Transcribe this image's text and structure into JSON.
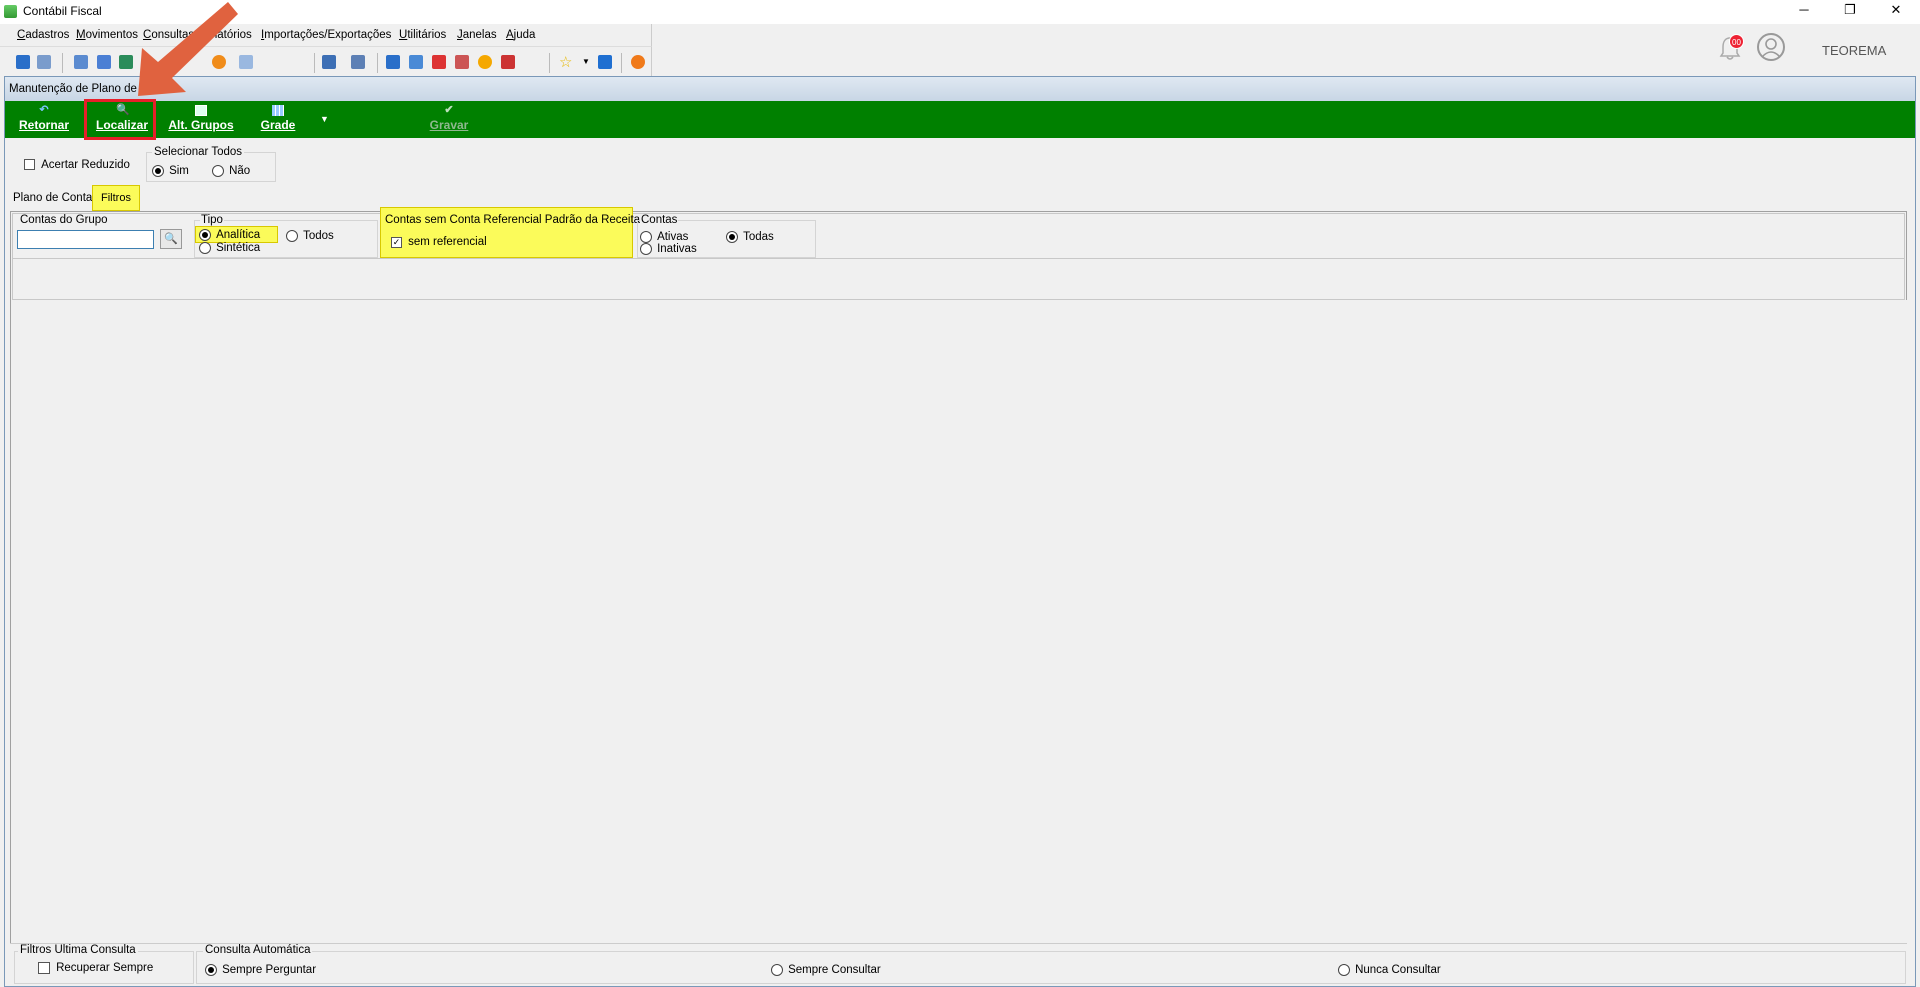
{
  "window": {
    "title": "Contábil Fiscal",
    "minimize": "─",
    "maximize": "❐",
    "close": "✕"
  },
  "menu": [
    {
      "u": "C",
      "rest": "adastros"
    },
    {
      "u": "M",
      "rest": "ovimentos"
    },
    {
      "u": "C",
      "rest": "onsultas"
    },
    {
      "u": "R",
      "rest": "elatórios"
    },
    {
      "u": "I",
      "rest": "mportações/Exportações"
    },
    {
      "u": "U",
      "rest": "tilitários"
    },
    {
      "u": "J",
      "rest": "anelas"
    },
    {
      "u": "A",
      "rest": "juda"
    }
  ],
  "user": {
    "notifications": "00",
    "name": "TEOREMA"
  },
  "form": {
    "title": "Manutenção de Plano de",
    "buttons": {
      "retornar": "Retornar",
      "localizar": "Localizar",
      "alt_grupos": "Alt. Grupos",
      "grade": "Grade",
      "gravar": "Gravar"
    },
    "acertar_reduzido": "Acertar Reduzido",
    "selecionar_todos": {
      "label": "Selecionar Todos",
      "sim": "Sim",
      "nao": "Não",
      "selected": "Sim"
    },
    "tabs": {
      "plano": "Plano de Contas",
      "filtros": "Filtros"
    },
    "filters": {
      "contas_grupo": {
        "label": "Contas do Grupo",
        "value": ""
      },
      "tipo": {
        "label": "Tipo",
        "analitica": "Analítica",
        "sintetica": "Sintética",
        "todos": "Todos",
        "selected": "Analítica"
      },
      "referencial": {
        "label": "Contas sem Conta Referencial Padrão da Receita",
        "check": "sem referencial",
        "checked": true
      },
      "contas": {
        "label": "Contas",
        "ativas": "Ativas",
        "inativas": "Inativas",
        "todas": "Todas",
        "selected": "Todas"
      }
    },
    "footer": {
      "filtros_ultima": "Filtros Ultima Consulta",
      "recuperar": "Recuperar Sempre",
      "consulta_auto": "Consulta Automática",
      "sempre_perguntar": "Sempre Perguntar",
      "sempre_consultar": "Sempre Consultar",
      "nunca_consultar": "Nunca Consultar",
      "selected": "Sempre Perguntar"
    }
  },
  "colors": {
    "green_bar": "#008000",
    "highlight_yellow": "#fbfb5a",
    "highlight_red": "#e8202a",
    "arrow": "#e0623f"
  }
}
